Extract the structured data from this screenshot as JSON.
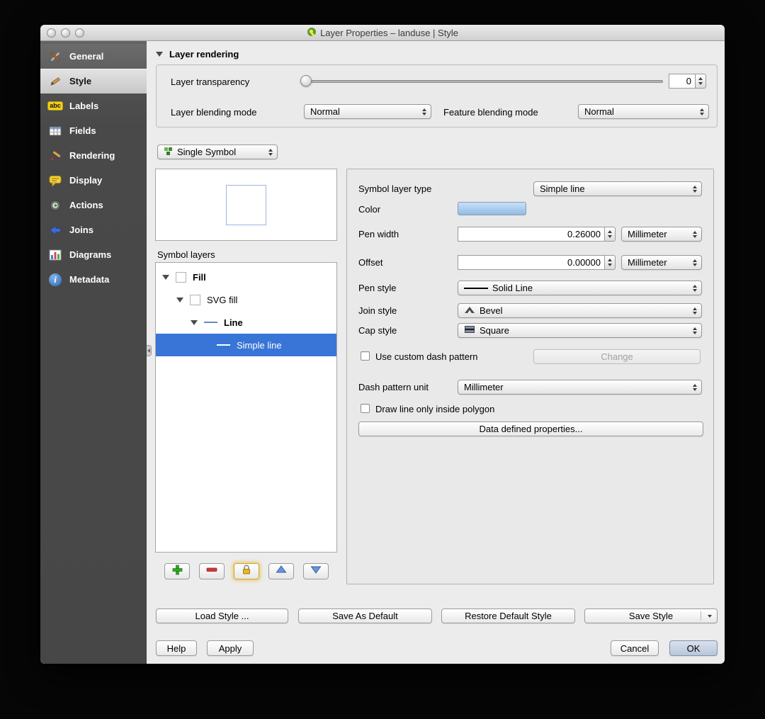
{
  "window": {
    "title": "Layer Properties – landuse | Style"
  },
  "sidebar": {
    "items": [
      {
        "label": "General"
      },
      {
        "label": "Style"
      },
      {
        "label": "Labels",
        "icon_text": "abc"
      },
      {
        "label": "Fields"
      },
      {
        "label": "Rendering"
      },
      {
        "label": "Display"
      },
      {
        "label": "Actions"
      },
      {
        "label": "Joins"
      },
      {
        "label": "Diagrams"
      },
      {
        "label": "Metadata",
        "icon_text": "i"
      }
    ]
  },
  "layer_rendering": {
    "header": "Layer rendering",
    "transparency_label": "Layer transparency",
    "transparency_value": "0",
    "blending_mode_label": "Layer blending mode",
    "blending_mode_value": "Normal",
    "feature_blending_label": "Feature blending mode",
    "feature_blending_value": "Normal"
  },
  "renderer": {
    "value": "Single Symbol"
  },
  "symbol_layers": {
    "label": "Symbol layers",
    "tree": [
      {
        "label": "Fill"
      },
      {
        "label": "SVG fill"
      },
      {
        "label": "Line"
      },
      {
        "label": "Simple line"
      }
    ]
  },
  "properties": {
    "symbol_layer_type_label": "Symbol layer type",
    "symbol_layer_type_value": "Simple line",
    "color_label": "Color",
    "pen_width_label": "Pen width",
    "pen_width_value": "0.26000",
    "pen_width_unit": "Millimeter",
    "offset_label": "Offset",
    "offset_value": "0.00000",
    "offset_unit": "Millimeter",
    "pen_style_label": "Pen style",
    "pen_style_value": "Solid Line",
    "join_style_label": "Join style",
    "join_style_value": "Bevel",
    "cap_style_label": "Cap style",
    "cap_style_value": "Square",
    "use_custom_dash_label": "Use custom dash pattern",
    "change_button": "Change",
    "dash_pattern_unit_label": "Dash pattern unit",
    "dash_pattern_unit_value": "Millimeter",
    "draw_inside_polygon_label": "Draw line only inside polygon",
    "data_defined_button": "Data defined properties..."
  },
  "footer": {
    "load_style": "Load Style ...",
    "save_as_default": "Save As Default",
    "restore_default_style": "Restore Default Style",
    "save_style": "Save Style",
    "help": "Help",
    "apply": "Apply",
    "cancel": "Cancel",
    "ok": "OK"
  },
  "colors": {
    "selection_blue": "#3875d7",
    "color_swatch": "#9bc7f2",
    "sidebar_background": "#4a4a4a"
  }
}
